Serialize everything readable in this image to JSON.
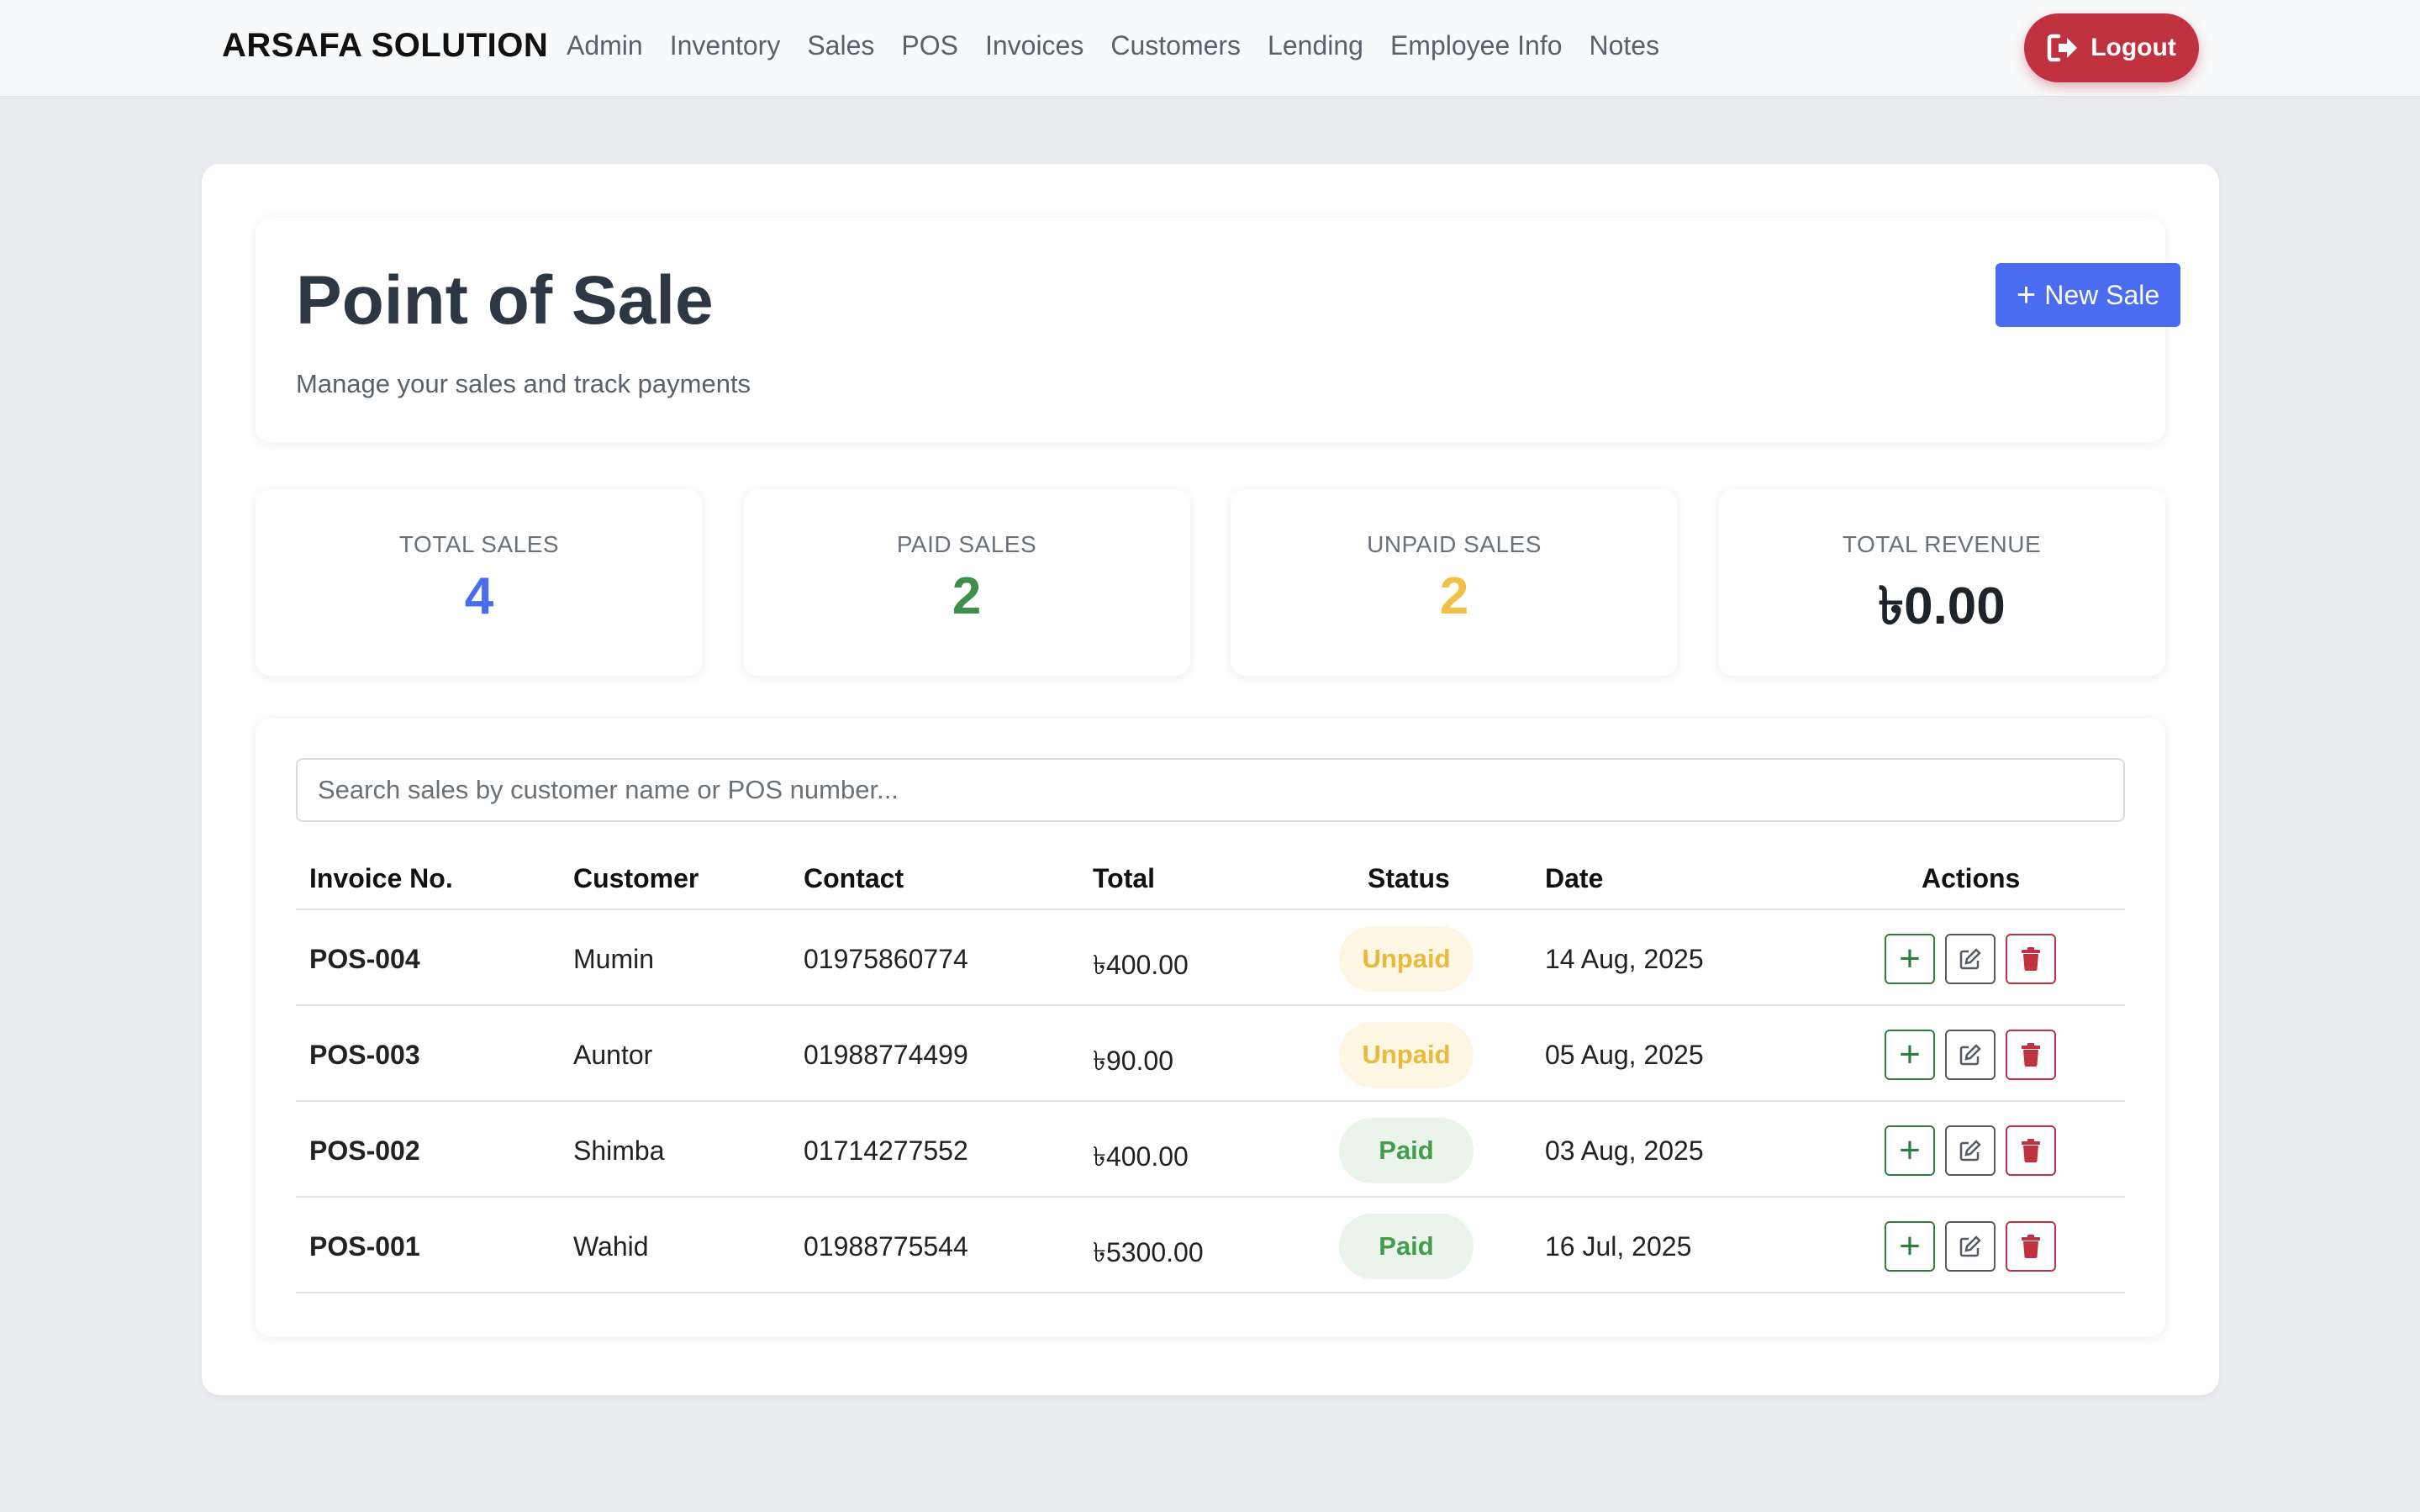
{
  "navbar": {
    "brand": "ARSAFA SOLUTION",
    "links": [
      "Admin",
      "Inventory",
      "Sales",
      "POS",
      "Invoices",
      "Customers",
      "Lending",
      "Employee Info",
      "Notes"
    ],
    "logout_label": "Logout"
  },
  "header": {
    "title": "Point of Sale",
    "subtitle": "Manage your sales and track payments",
    "new_sale_label": "New Sale"
  },
  "stats": [
    {
      "label": "TOTAL SALES",
      "value": "4",
      "color": "#4a6cf0"
    },
    {
      "label": "PAID SALES",
      "value": "2",
      "color": "#3e8e4c"
    },
    {
      "label": "UNPAID SALES",
      "value": "2",
      "color": "#f0c146"
    },
    {
      "label": "TOTAL REVENUE",
      "value": "৳0.00",
      "color": "#1f242a"
    }
  ],
  "search": {
    "placeholder": "Search sales by customer name or POS number...",
    "value": ""
  },
  "table": {
    "headers": {
      "invoice": "Invoice No.",
      "customer": "Customer",
      "contact": "Contact",
      "total": "Total",
      "status": "Status",
      "date": "Date",
      "actions": "Actions"
    },
    "rows": [
      {
        "invoice": "POS-004",
        "customer": "Mumin",
        "contact": "01975860774",
        "total": "৳400.00",
        "status": "Unpaid",
        "date": "14 Aug, 2025"
      },
      {
        "invoice": "POS-003",
        "customer": "Auntor",
        "contact": "01988774499",
        "total": "৳90.00",
        "status": "Unpaid",
        "date": "05 Aug, 2025"
      },
      {
        "invoice": "POS-002",
        "customer": "Shimba",
        "contact": "01714277552",
        "total": "৳400.00",
        "status": "Paid",
        "date": "03 Aug, 2025"
      },
      {
        "invoice": "POS-001",
        "customer": "Wahid",
        "contact": "01988775544",
        "total": "৳5300.00",
        "status": "Paid",
        "date": "16 Jul, 2025"
      }
    ],
    "action_icons": [
      "plus-icon",
      "edit-icon",
      "trash-icon"
    ]
  },
  "colors": {
    "primary": "#4a6cf0",
    "danger": "#c0323f",
    "success": "#3e8e4c",
    "warning": "#f0c146"
  }
}
